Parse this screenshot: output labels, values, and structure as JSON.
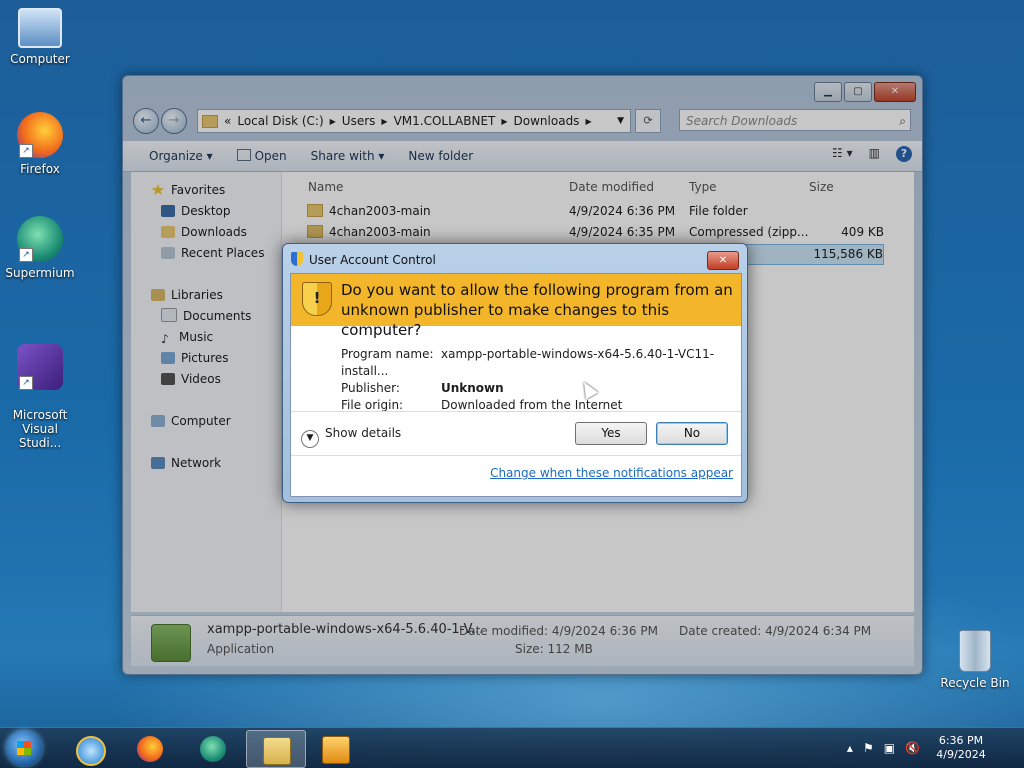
{
  "desktop": {
    "icons": [
      {
        "label": "Computer"
      },
      {
        "label": "Firefox"
      },
      {
        "label": "Supermium"
      },
      {
        "label": "Microsoft\nVisual Studi..."
      },
      {
        "label": "Recycle Bin"
      }
    ]
  },
  "explorer": {
    "address": {
      "chevrons": "«",
      "crumbs": [
        "Local Disk (C:)",
        "Users",
        "VM1.COLLABNET",
        "Downloads"
      ]
    },
    "search": {
      "placeholder": "Search Downloads"
    },
    "toolbar": {
      "organize": "Organize ▾",
      "open": "Open",
      "share": "Share with ▾",
      "new_folder": "New folder"
    },
    "nav": {
      "favorites": "Favorites",
      "desktop": "Desktop",
      "downloads": "Downloads",
      "recent": "Recent Places",
      "libraries": "Libraries",
      "documents": "Documents",
      "music": "Music",
      "pictures": "Pictures",
      "videos": "Videos",
      "computer": "Computer",
      "network": "Network"
    },
    "columns": {
      "name": "Name",
      "date": "Date modified",
      "type": "Type",
      "size": "Size"
    },
    "files": [
      {
        "name": "4chan2003-main",
        "date": "4/9/2024 6:36 PM",
        "type": "File folder",
        "size": ""
      },
      {
        "name": "4chan2003-main",
        "date": "4/9/2024 6:35 PM",
        "type": "Compressed (zipp...",
        "size": "409 KB"
      },
      {
        "name": "",
        "date": "",
        "type": "",
        "size": "115,586 KB"
      }
    ],
    "details": {
      "name": "xampp-portable-windows-x64-5.6.40-1-V...",
      "kind": "Application",
      "modified": "Date modified: 4/9/2024 6:36 PM",
      "size": "Size: 112 MB",
      "created": "Date created: 4/9/2024 6:34 PM"
    }
  },
  "uac": {
    "title": "User Account Control",
    "question": "Do you want to allow the following program from an unknown publisher to make changes to this computer?",
    "program_label": "Program name:",
    "program_value": "xampp-portable-windows-x64-5.6.40-1-VC11-install...",
    "publisher_label": "Publisher:",
    "publisher_value": "Unknown",
    "origin_label": "File origin:",
    "origin_value": "Downloaded from the Internet",
    "show_details": "Show details",
    "yes": "Yes",
    "no": "No",
    "link": "Change when these notifications appear",
    "close_glyph": "✕"
  },
  "taskbar": {
    "time": "6:36 PM",
    "date": "4/9/2024"
  }
}
